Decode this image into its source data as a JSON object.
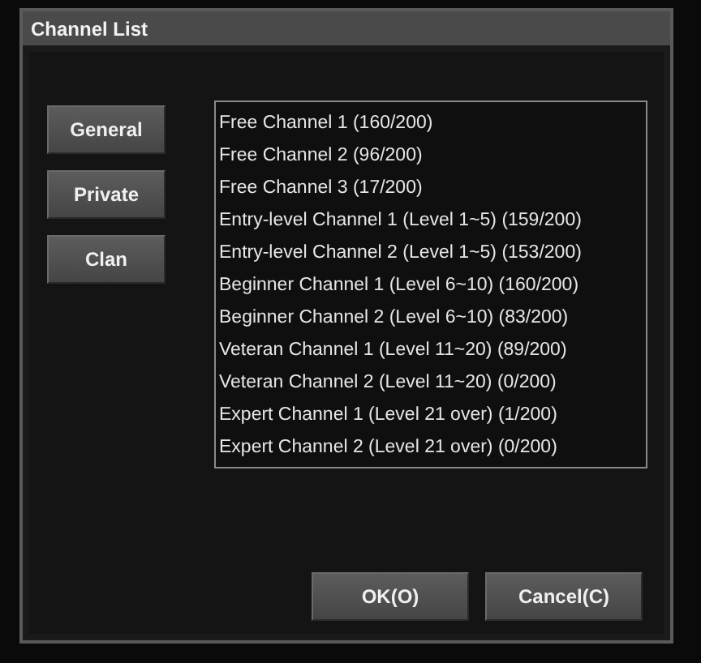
{
  "window": {
    "title": "Channel List"
  },
  "categories": [
    "General",
    "Private",
    "Clan"
  ],
  "channels": [
    "Free Channel 1 (160/200)",
    "Free Channel 2 (96/200)",
    "Free Channel 3 (17/200)",
    "Entry-level Channel 1 (Level 1~5) (159/200)",
    "Entry-level Channel 2 (Level 1~5) (153/200)",
    "Beginner Channel 1 (Level 6~10) (160/200)",
    "Beginner Channel 2 (Level 6~10) (83/200)",
    "Veteran Channel 1 (Level 11~20) (89/200)",
    "Veteran Channel 2 (Level 11~20) (0/200)",
    "Expert Channel 1 (Level 21 over) (1/200)",
    "Expert Channel 2 (Level 21 over) (0/200)"
  ],
  "buttons": [
    "OK(O)",
    "Cancel(C)"
  ]
}
